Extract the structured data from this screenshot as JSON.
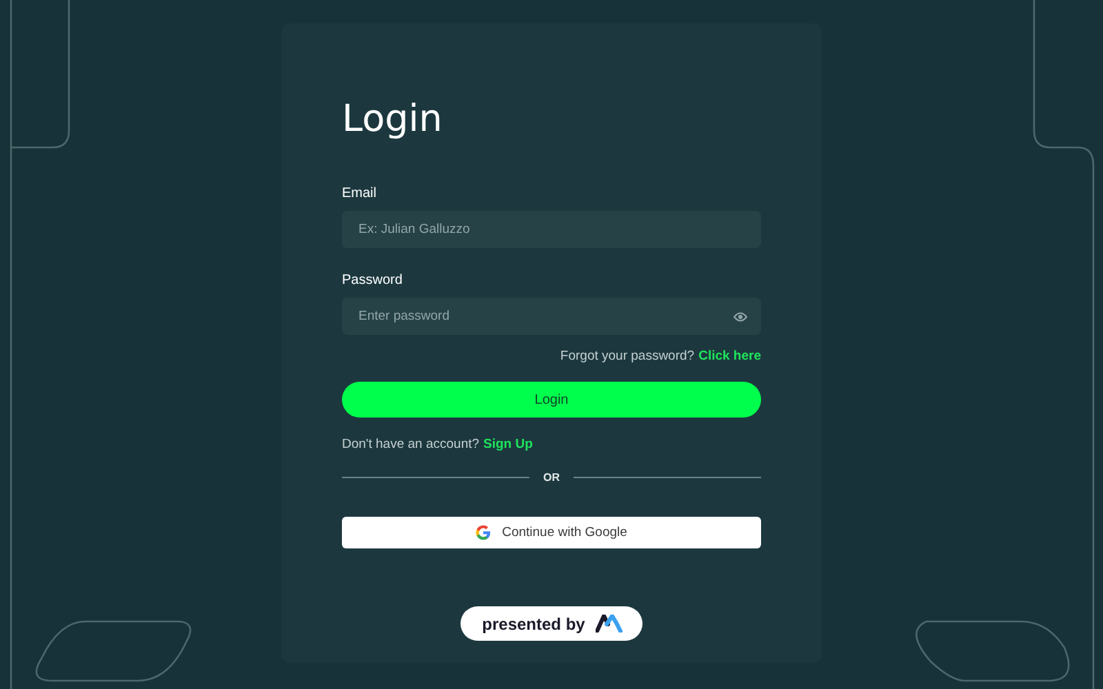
{
  "title": "Login",
  "fields": [
    {
      "label": "Email",
      "placeholder": "Ex: Julian Galluzzo",
      "kind": "text"
    },
    {
      "label": "Password",
      "placeholder": "Enter password",
      "kind": "password"
    }
  ],
  "forgot": {
    "text": "Forgot your password?",
    "link": "Click here"
  },
  "submit": "Login",
  "signup": {
    "text": "Don't have an account?",
    "link": "Sign Up"
  },
  "divider": "OR",
  "google": "Continue with Google",
  "badge": "presented by"
}
